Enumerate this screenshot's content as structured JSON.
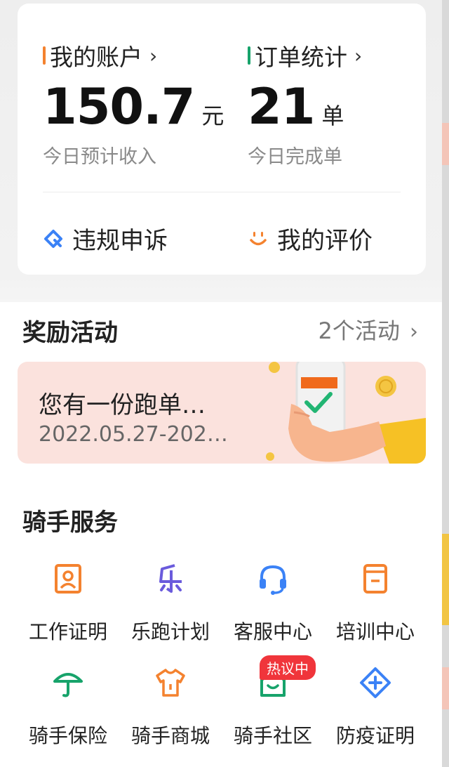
{
  "account": {
    "title": "我的账户",
    "value": "150.7",
    "unit": "元",
    "sub": "今日预计收入"
  },
  "orders": {
    "title": "订单统计",
    "value": "21",
    "unit": "单",
    "sub": "今日完成单"
  },
  "actions": {
    "appeal": "违规申诉",
    "rating": "我的评价"
  },
  "rewards": {
    "title": "奖励活动",
    "more": "2个活动"
  },
  "banner": {
    "title": "您有一份跑单…",
    "date": "2022.05.27-202…"
  },
  "services": {
    "title": "骑手服务",
    "hot_badge": "热议中",
    "items": [
      {
        "label": "工作证明",
        "icon": "id-card-icon",
        "color": "#f4822f"
      },
      {
        "label": "乐跑计划",
        "icon": "le-run-icon",
        "color": "#6a5bdc"
      },
      {
        "label": "客服中心",
        "icon": "headset-icon",
        "color": "#3b82f6"
      },
      {
        "label": "培训中心",
        "icon": "training-icon",
        "color": "#f4822f"
      },
      {
        "label": "骑手保险",
        "icon": "umbrella-icon",
        "color": "#17a36b"
      },
      {
        "label": "骑手商城",
        "icon": "shirt-icon",
        "color": "#f4822f"
      },
      {
        "label": "骑手社区",
        "icon": "house-icon",
        "color": "#17a36b"
      },
      {
        "label": "防疫证明",
        "icon": "plus-diamond-icon",
        "color": "#3b82f6"
      }
    ]
  },
  "colors": {
    "orange": "#f4822f",
    "green": "#17a36b",
    "blue": "#3b82f6",
    "banner_bg": "#fbe2dd",
    "hot_red": "#f0353b"
  }
}
